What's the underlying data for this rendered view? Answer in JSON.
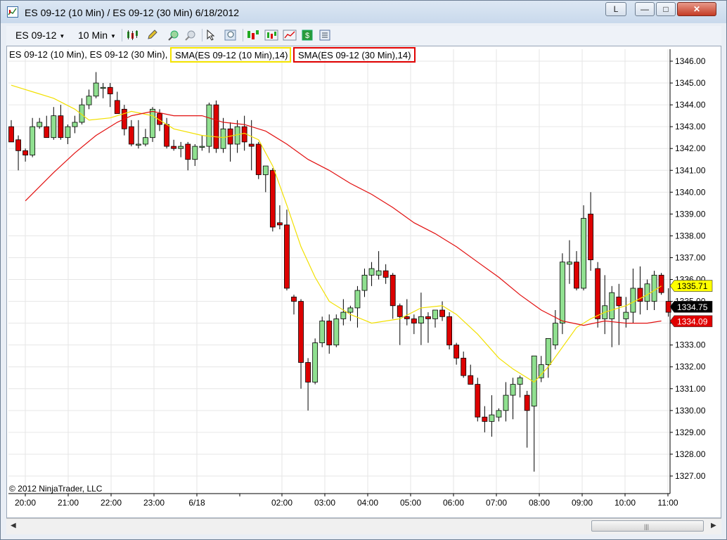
{
  "window": {
    "title": "ES 09-12 (10 Min) / ES 09-12 (30 Min)  6/18/2012",
    "min_label": "L",
    "close_label": "✕",
    "minimize_label": "—",
    "maximize_label": "□"
  },
  "toolbar": {
    "instrument": "ES 09-12",
    "interval": "10 Min"
  },
  "legend": {
    "main": "ES 09-12 (10 Min), ES 09-12 (30 Min),",
    "sma10": "SMA(ES 09-12 (10 Min),14)",
    "sma30": "SMA(ES 09-12 (30 Min),14)"
  },
  "copyright": "© 2012 NinjaTrader, LLC",
  "price_axis": [
    "1346.00",
    "1345.00",
    "1344.00",
    "1343.00",
    "1342.00",
    "1341.00",
    "1340.00",
    "1339.00",
    "1338.00",
    "1337.00",
    "1336.00",
    "1335.00",
    "1334.00",
    "1333.00",
    "1332.00",
    "1331.00",
    "1330.00",
    "1329.00",
    "1328.00",
    "1327.00"
  ],
  "time_axis": [
    "20:00",
    "21:00",
    "22:00",
    "23:00",
    "6/18",
    "02:00",
    "03:00",
    "04:00",
    "05:00",
    "06:00",
    "07:00",
    "08:00",
    "09:00",
    "10:00",
    "11:00"
  ],
  "price_tags": {
    "sma10": "1335.71",
    "last": "1334.75",
    "sma30": "1334.09"
  },
  "colors": {
    "up": "#90e090",
    "down": "#dd0000",
    "sma10": "#f2e000",
    "sma30": "#e21010",
    "grid": "#e6e6e6",
    "tag_sma10": "#ffff00",
    "tag_last": "#000000",
    "tag_sma30": "#e00000"
  },
  "chart_data": {
    "type": "candlestick",
    "ylim": [
      1326.5,
      1346.3
    ],
    "candles": [
      {
        "o": 1343.0,
        "h": 1343.3,
        "l": 1342.3,
        "c": 1342.3
      },
      {
        "o": 1342.4,
        "h": 1342.6,
        "l": 1341.0,
        "c": 1341.9
      },
      {
        "o": 1341.9,
        "h": 1342.0,
        "l": 1341.4,
        "c": 1341.7
      },
      {
        "o": 1341.7,
        "h": 1343.4,
        "l": 1341.6,
        "c": 1343.0
      },
      {
        "o": 1343.0,
        "h": 1343.4,
        "l": 1342.9,
        "c": 1343.2
      },
      {
        "o": 1343.0,
        "h": 1343.5,
        "l": 1342.6,
        "c": 1342.5
      },
      {
        "o": 1342.5,
        "h": 1343.9,
        "l": 1342.4,
        "c": 1343.5
      },
      {
        "o": 1343.5,
        "h": 1344.0,
        "l": 1342.4,
        "c": 1342.5
      },
      {
        "o": 1342.5,
        "h": 1343.1,
        "l": 1342.2,
        "c": 1343.0
      },
      {
        "o": 1343.0,
        "h": 1343.5,
        "l": 1342.7,
        "c": 1343.2
      },
      {
        "o": 1343.2,
        "h": 1344.3,
        "l": 1343.1,
        "c": 1344.0
      },
      {
        "o": 1344.0,
        "h": 1344.7,
        "l": 1343.8,
        "c": 1344.4
      },
      {
        "o": 1344.4,
        "h": 1345.5,
        "l": 1344.3,
        "c": 1345.0
      },
      {
        "o": 1344.8,
        "h": 1345.0,
        "l": 1344.3,
        "c": 1344.8
      },
      {
        "o": 1344.8,
        "h": 1345.0,
        "l": 1343.9,
        "c": 1344.5
      },
      {
        "o": 1344.2,
        "h": 1344.6,
        "l": 1343.6,
        "c": 1343.6
      },
      {
        "o": 1343.8,
        "h": 1344.0,
        "l": 1342.6,
        "c": 1342.9
      },
      {
        "o": 1343.0,
        "h": 1343.3,
        "l": 1342.1,
        "c": 1342.2
      },
      {
        "o": 1342.2,
        "h": 1343.3,
        "l": 1342.0,
        "c": 1342.2
      },
      {
        "o": 1342.2,
        "h": 1342.9,
        "l": 1342.1,
        "c": 1342.5
      },
      {
        "o": 1342.5,
        "h": 1343.9,
        "l": 1342.3,
        "c": 1343.8
      },
      {
        "o": 1343.6,
        "h": 1343.8,
        "l": 1342.8,
        "c": 1343.1
      },
      {
        "o": 1343.1,
        "h": 1343.4,
        "l": 1342.0,
        "c": 1342.1
      },
      {
        "o": 1342.1,
        "h": 1342.4,
        "l": 1341.9,
        "c": 1342.0
      },
      {
        "o": 1342.0,
        "h": 1342.3,
        "l": 1341.6,
        "c": 1342.1
      },
      {
        "o": 1342.2,
        "h": 1342.3,
        "l": 1341.0,
        "c": 1341.5
      },
      {
        "o": 1341.5,
        "h": 1342.2,
        "l": 1341.2,
        "c": 1342.1
      },
      {
        "o": 1342.1,
        "h": 1342.6,
        "l": 1341.9,
        "c": 1342.1
      },
      {
        "o": 1342.1,
        "h": 1344.1,
        "l": 1341.8,
        "c": 1344.0
      },
      {
        "o": 1344.0,
        "h": 1344.2,
        "l": 1341.8,
        "c": 1342.0
      },
      {
        "o": 1342.0,
        "h": 1343.4,
        "l": 1341.8,
        "c": 1342.9
      },
      {
        "o": 1342.9,
        "h": 1343.2,
        "l": 1341.4,
        "c": 1342.2
      },
      {
        "o": 1342.2,
        "h": 1343.3,
        "l": 1341.8,
        "c": 1343.0
      },
      {
        "o": 1343.0,
        "h": 1343.5,
        "l": 1341.9,
        "c": 1342.3
      },
      {
        "o": 1342.2,
        "h": 1343.3,
        "l": 1341.0,
        "c": 1342.1
      },
      {
        "o": 1342.2,
        "h": 1342.3,
        "l": 1340.6,
        "c": 1340.8
      },
      {
        "o": 1340.8,
        "h": 1341.2,
        "l": 1340.0,
        "c": 1341.2
      },
      {
        "o": 1341.0,
        "h": 1341.1,
        "l": 1338.2,
        "c": 1338.4
      },
      {
        "o": 1338.6,
        "h": 1339.4,
        "l": 1338.3,
        "c": 1338.5
      },
      {
        "o": 1338.5,
        "h": 1339.2,
        "l": 1335.5,
        "c": 1335.6
      },
      {
        "o": 1335.2,
        "h": 1335.3,
        "l": 1334.4,
        "c": 1335.0
      },
      {
        "o": 1335.0,
        "h": 1335.1,
        "l": 1331.0,
        "c": 1332.2
      },
      {
        "o": 1332.2,
        "h": 1332.4,
        "l": 1330.0,
        "c": 1331.3
      },
      {
        "o": 1331.3,
        "h": 1333.3,
        "l": 1331.2,
        "c": 1333.1
      },
      {
        "o": 1333.1,
        "h": 1334.3,
        "l": 1332.9,
        "c": 1334.1
      },
      {
        "o": 1334.1,
        "h": 1334.4,
        "l": 1332.6,
        "c": 1333.0
      },
      {
        "o": 1333.0,
        "h": 1334.4,
        "l": 1332.9,
        "c": 1334.2
      },
      {
        "o": 1334.2,
        "h": 1335.1,
        "l": 1333.9,
        "c": 1334.5
      },
      {
        "o": 1334.5,
        "h": 1334.8,
        "l": 1334.1,
        "c": 1334.7
      },
      {
        "o": 1334.7,
        "h": 1335.7,
        "l": 1333.8,
        "c": 1335.5
      },
      {
        "o": 1335.5,
        "h": 1336.5,
        "l": 1335.2,
        "c": 1336.2
      },
      {
        "o": 1336.2,
        "h": 1336.8,
        "l": 1335.7,
        "c": 1336.5
      },
      {
        "o": 1336.2,
        "h": 1337.3,
        "l": 1336.0,
        "c": 1336.4
      },
      {
        "o": 1336.4,
        "h": 1336.7,
        "l": 1335.8,
        "c": 1336.1
      },
      {
        "o": 1336.2,
        "h": 1336.3,
        "l": 1334.2,
        "c": 1334.8
      },
      {
        "o": 1334.8,
        "h": 1334.9,
        "l": 1333.0,
        "c": 1334.3
      },
      {
        "o": 1334.3,
        "h": 1335.1,
        "l": 1333.9,
        "c": 1334.2
      },
      {
        "o": 1334.2,
        "h": 1334.4,
        "l": 1333.5,
        "c": 1334.0
      },
      {
        "o": 1334.0,
        "h": 1335.4,
        "l": 1333.0,
        "c": 1334.3
      },
      {
        "o": 1334.3,
        "h": 1334.5,
        "l": 1333.1,
        "c": 1334.2
      },
      {
        "o": 1334.2,
        "h": 1334.6,
        "l": 1333.8,
        "c": 1334.6
      },
      {
        "o": 1334.6,
        "h": 1335.0,
        "l": 1334.1,
        "c": 1334.3
      },
      {
        "o": 1334.3,
        "h": 1334.5,
        "l": 1332.8,
        "c": 1333.0
      },
      {
        "o": 1333.0,
        "h": 1333.1,
        "l": 1332.1,
        "c": 1332.4
      },
      {
        "o": 1332.4,
        "h": 1332.7,
        "l": 1331.5,
        "c": 1331.6
      },
      {
        "o": 1331.6,
        "h": 1332.1,
        "l": 1331.2,
        "c": 1331.2
      },
      {
        "o": 1331.2,
        "h": 1331.5,
        "l": 1329.5,
        "c": 1329.7
      },
      {
        "o": 1329.7,
        "h": 1330.2,
        "l": 1329.0,
        "c": 1329.5
      },
      {
        "o": 1329.5,
        "h": 1330.7,
        "l": 1328.8,
        "c": 1329.8
      },
      {
        "o": 1329.7,
        "h": 1330.1,
        "l": 1329.5,
        "c": 1330.0
      },
      {
        "o": 1330.0,
        "h": 1331.3,
        "l": 1329.5,
        "c": 1330.7
      },
      {
        "o": 1330.7,
        "h": 1331.5,
        "l": 1329.6,
        "c": 1331.2
      },
      {
        "o": 1331.2,
        "h": 1331.6,
        "l": 1330.6,
        "c": 1331.5
      },
      {
        "o": 1330.7,
        "h": 1330.9,
        "l": 1328.3,
        "c": 1330.0
      },
      {
        "o": 1330.2,
        "h": 1332.5,
        "l": 1327.2,
        "c": 1332.5
      },
      {
        "o": 1331.5,
        "h": 1332.5,
        "l": 1331.3,
        "c": 1332.1
      },
      {
        "o": 1332.1,
        "h": 1333.2,
        "l": 1331.5,
        "c": 1333.3
      },
      {
        "o": 1333.0,
        "h": 1334.6,
        "l": 1332.8,
        "c": 1334.0
      },
      {
        "o": 1334.0,
        "h": 1337.2,
        "l": 1333.5,
        "c": 1336.8
      },
      {
        "o": 1336.7,
        "h": 1337.8,
        "l": 1335.8,
        "c": 1336.8
      },
      {
        "o": 1336.8,
        "h": 1337.3,
        "l": 1335.5,
        "c": 1335.6
      },
      {
        "o": 1335.6,
        "h": 1339.4,
        "l": 1335.5,
        "c": 1338.8
      },
      {
        "o": 1339.0,
        "h": 1340.0,
        "l": 1336.4,
        "c": 1336.9
      },
      {
        "o": 1336.5,
        "h": 1336.8,
        "l": 1333.8,
        "c": 1334.2
      },
      {
        "o": 1334.2,
        "h": 1336.2,
        "l": 1333.5,
        "c": 1334.8
      },
      {
        "o": 1334.2,
        "h": 1335.7,
        "l": 1332.9,
        "c": 1335.4
      },
      {
        "o": 1335.2,
        "h": 1335.8,
        "l": 1333.0,
        "c": 1334.8
      },
      {
        "o": 1334.2,
        "h": 1335.2,
        "l": 1333.8,
        "c": 1334.5
      },
      {
        "o": 1334.5,
        "h": 1336.5,
        "l": 1334.0,
        "c": 1335.6
      },
      {
        "o": 1335.6,
        "h": 1336.6,
        "l": 1334.4,
        "c": 1335.0
      },
      {
        "o": 1335.0,
        "h": 1336.0,
        "l": 1334.6,
        "c": 1335.8
      },
      {
        "o": 1335.0,
        "h": 1336.4,
        "l": 1334.6,
        "c": 1336.2
      },
      {
        "o": 1336.2,
        "h": 1336.3,
        "l": 1335.3,
        "c": 1335.4
      },
      {
        "o": 1335.0,
        "h": 1335.6,
        "l": 1334.3,
        "c": 1334.5
      }
    ],
    "sma10": [
      [
        0,
        1344.9
      ],
      [
        3,
        1344.6
      ],
      [
        6,
        1344.3
      ],
      [
        9,
        1343.8
      ],
      [
        11,
        1343.3
      ],
      [
        14,
        1343.4
      ],
      [
        17,
        1343.7
      ],
      [
        20,
        1343.5
      ],
      [
        23,
        1342.9
      ],
      [
        27,
        1342.6
      ],
      [
        30,
        1342.5
      ],
      [
        33,
        1342.7
      ],
      [
        35,
        1342.4
      ],
      [
        37,
        1341.2
      ],
      [
        39,
        1339.4
      ],
      [
        41,
        1337.5
      ],
      [
        43,
        1336.1
      ],
      [
        45,
        1335.0
      ],
      [
        48,
        1334.4
      ],
      [
        51,
        1334.0
      ],
      [
        55,
        1334.2
      ],
      [
        58,
        1334.7
      ],
      [
        61,
        1334.8
      ],
      [
        63,
        1334.4
      ],
      [
        66,
        1333.5
      ],
      [
        69,
        1332.4
      ],
      [
        71,
        1331.9
      ],
      [
        73,
        1331.5
      ],
      [
        74,
        1331.3
      ],
      [
        76,
        1332.0
      ],
      [
        78,
        1332.9
      ],
      [
        80,
        1333.8
      ],
      [
        82,
        1334.2
      ],
      [
        84,
        1334.5
      ],
      [
        87,
        1334.8
      ],
      [
        90,
        1335.3
      ],
      [
        92,
        1335.7
      ]
    ],
    "sma30": [
      [
        2,
        1339.6
      ],
      [
        6,
        1340.9
      ],
      [
        9,
        1341.8
      ],
      [
        12,
        1342.6
      ],
      [
        15,
        1343.2
      ],
      [
        17,
        1343.5
      ],
      [
        20,
        1343.7
      ],
      [
        23,
        1343.5
      ],
      [
        27,
        1343.5
      ],
      [
        30,
        1343.2
      ],
      [
        33,
        1343.1
      ],
      [
        36,
        1342.8
      ],
      [
        39,
        1342.2
      ],
      [
        42,
        1341.5
      ],
      [
        45,
        1341.0
      ],
      [
        48,
        1340.4
      ],
      [
        51,
        1339.9
      ],
      [
        54,
        1339.3
      ],
      [
        57,
        1338.6
      ],
      [
        60,
        1338.1
      ],
      [
        63,
        1337.5
      ],
      [
        66,
        1336.8
      ],
      [
        69,
        1336.1
      ],
      [
        72,
        1335.3
      ],
      [
        75,
        1334.6
      ],
      [
        78,
        1334.1
      ],
      [
        81,
        1333.9
      ],
      [
        84,
        1334.1
      ],
      [
        87,
        1334.0
      ],
      [
        90,
        1334.0
      ],
      [
        92,
        1334.1
      ]
    ]
  }
}
